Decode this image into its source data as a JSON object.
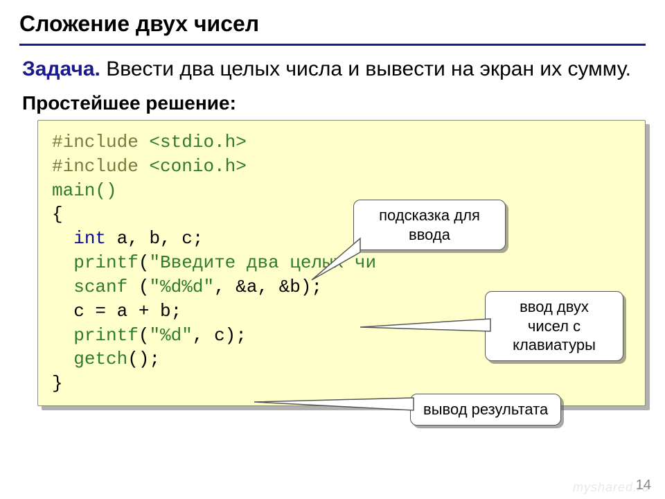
{
  "title": "Сложение двух чисел",
  "task": {
    "label": "Задача.",
    "text": " Ввести два целых числа и вывести на экран их сумму."
  },
  "solution_label": "Простейшее решение:",
  "code": {
    "l1": {
      "pre": "#include",
      "inc": " <stdio.h>"
    },
    "l2": {
      "pre": "#include",
      "inc": " <conio.h>"
    },
    "l3": "main()",
    "l4": "{",
    "l5": {
      "kw": "int",
      "rest": " a, b, c;"
    },
    "l6": {
      "fn": "printf",
      "paren": "(",
      "str": "\"Введите два целых чи",
      "close": ""
    },
    "l7": {
      "fn": "scanf ",
      "paren": "(",
      "str": "\"%d%d\"",
      "rest": ", &a, &b);"
    },
    "l8": "  c = a + b;",
    "l9": {
      "fn": "printf",
      "paren": "(",
      "str": "\"%d\"",
      "rest": ", c);"
    },
    "l10": {
      "fn": "getch",
      "rest": "();"
    },
    "l11": "}"
  },
  "callouts": {
    "c1": "подсказка для\nввода",
    "c2": "ввод двух\nчисел с\nклавиатуры",
    "c3": "вывод результата"
  },
  "page_number": "14",
  "watermark": "myshared.ru"
}
